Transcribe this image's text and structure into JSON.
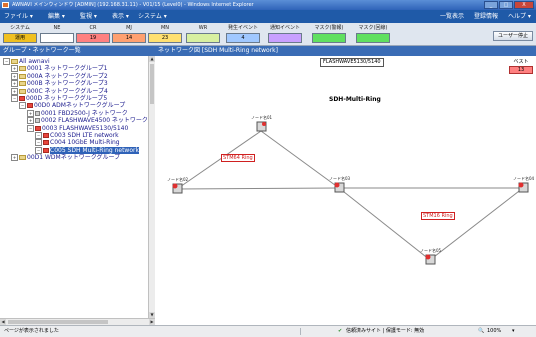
{
  "window": {
    "title": "AWNAVI メインウィンドウ [ADMIN] (192.168.31.11) - V01/15 (Level0) - Windows Internet Explorer",
    "buttons": [
      "_",
      "□",
      "X"
    ]
  },
  "menubar": {
    "left": [
      "ファイル ▾",
      "編集 ▾",
      "監視 ▾",
      "表示 ▾",
      "システム ▾"
    ],
    "right": [
      "一覧表示",
      "登録情報",
      "ヘルプ ▾"
    ]
  },
  "status": {
    "system_label": "システム",
    "system_value": "運用",
    "columns": [
      {
        "label": "NE",
        "value": "",
        "color": "#ffffff"
      },
      {
        "label": "CR",
        "value": "19",
        "color": "#ff8080"
      },
      {
        "label": "MJ",
        "value": "14",
        "color": "#ffa070"
      },
      {
        "label": "MN",
        "value": "23",
        "color": "#ffe070"
      },
      {
        "label": "WR",
        "value": "",
        "color": "#d8f0a0"
      },
      {
        "label": "発生イベント",
        "value": "4",
        "color": "#a0c8ff"
      },
      {
        "label": "通知イベント",
        "value": "",
        "color": "#c8a0ff"
      },
      {
        "label": "マスク(警報)",
        "value": "",
        "color": "#60e060"
      },
      {
        "label": "マスク(回線)",
        "value": "",
        "color": "#60e060"
      }
    ],
    "user_button": "ユーザー停止"
  },
  "left_panel": {
    "header": "グループ・ネットワーク一覧",
    "tree": [
      {
        "indent": 0,
        "icon": "root",
        "text": "All awnavi"
      },
      {
        "indent": 1,
        "icon": "folder",
        "text": "0001 ネットワークグループ1"
      },
      {
        "indent": 1,
        "icon": "folder",
        "text": "000A ネットワークグループ2"
      },
      {
        "indent": 1,
        "icon": "folder",
        "text": "000B ネットワークグループ3"
      },
      {
        "indent": 1,
        "icon": "folder",
        "text": "000C ネットワークグループ4"
      },
      {
        "indent": 1,
        "icon": "alarm",
        "text": "000D ネットワークグループ5"
      },
      {
        "indent": 2,
        "icon": "alarm",
        "text": "00D0 ADMネットワークグループ"
      },
      {
        "indent": 3,
        "icon": "device",
        "text": "0001 FBD2500-J ネットワーク"
      },
      {
        "indent": 3,
        "icon": "device",
        "text": "0002 FLASHWAVE4500 ネットワーク"
      },
      {
        "indent": 3,
        "icon": "alarm",
        "text": "0003 FLASHWAVE5130/5140"
      },
      {
        "indent": 4,
        "icon": "alarm",
        "text": "C003 SDH LTE network"
      },
      {
        "indent": 4,
        "icon": "alarm",
        "text": "C004 10GbE Multi-Ring"
      },
      {
        "indent": 4,
        "icon": "alarm",
        "text": "C005 SDH Multi-Ring network",
        "selected": true
      },
      {
        "indent": 1,
        "icon": "folder",
        "text": "00D1 WDMネットワークグループ"
      }
    ]
  },
  "right_panel": {
    "header": "ネットワーク図 [SDH Multi-Ring network]",
    "device_select": "FLASHWAVE5130/5140",
    "map_title": "SDH-Multi-Ring",
    "ring_labels": [
      "STM64 Ring",
      "STM16 Ring"
    ],
    "node_labels": [
      "ノード名01",
      "ノード名02",
      "ノード名03",
      "ノード名04",
      "ノード名05"
    ],
    "corner_label": "ベスト",
    "corner_value": "13"
  },
  "statusbar": {
    "left": "ページが表示されました",
    "middle": "信頼済みサイト | 保護モード: 無効",
    "zoom": "100%"
  }
}
